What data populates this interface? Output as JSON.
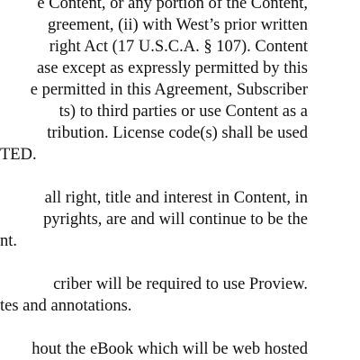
{
  "document": {
    "paragraphs": [
      {
        "lines": [
          "e Content, or any portion of the Content,",
          "greement, (ii) with West’s prior written",
          "right Act (17 U.S.C.A. § 107).  Content",
          "ase except as expressly permitted by this",
          "e permitted in this Agreement, Subscriber",
          "ts) to third parties or use Content as a",
          "tribution.  License code(s) shall be used",
          "TED."
        ]
      },
      {
        "lines": [
          " all right, title and interest in Content, in",
          "pyrights, are and will continue to be the",
          "nt."
        ]
      },
      {
        "lines": [
          "criber will be required to use Proview.",
          "tes and annotations."
        ]
      },
      {
        "lines": [
          "hout the eBook which will be web hosted"
        ]
      }
    ]
  }
}
